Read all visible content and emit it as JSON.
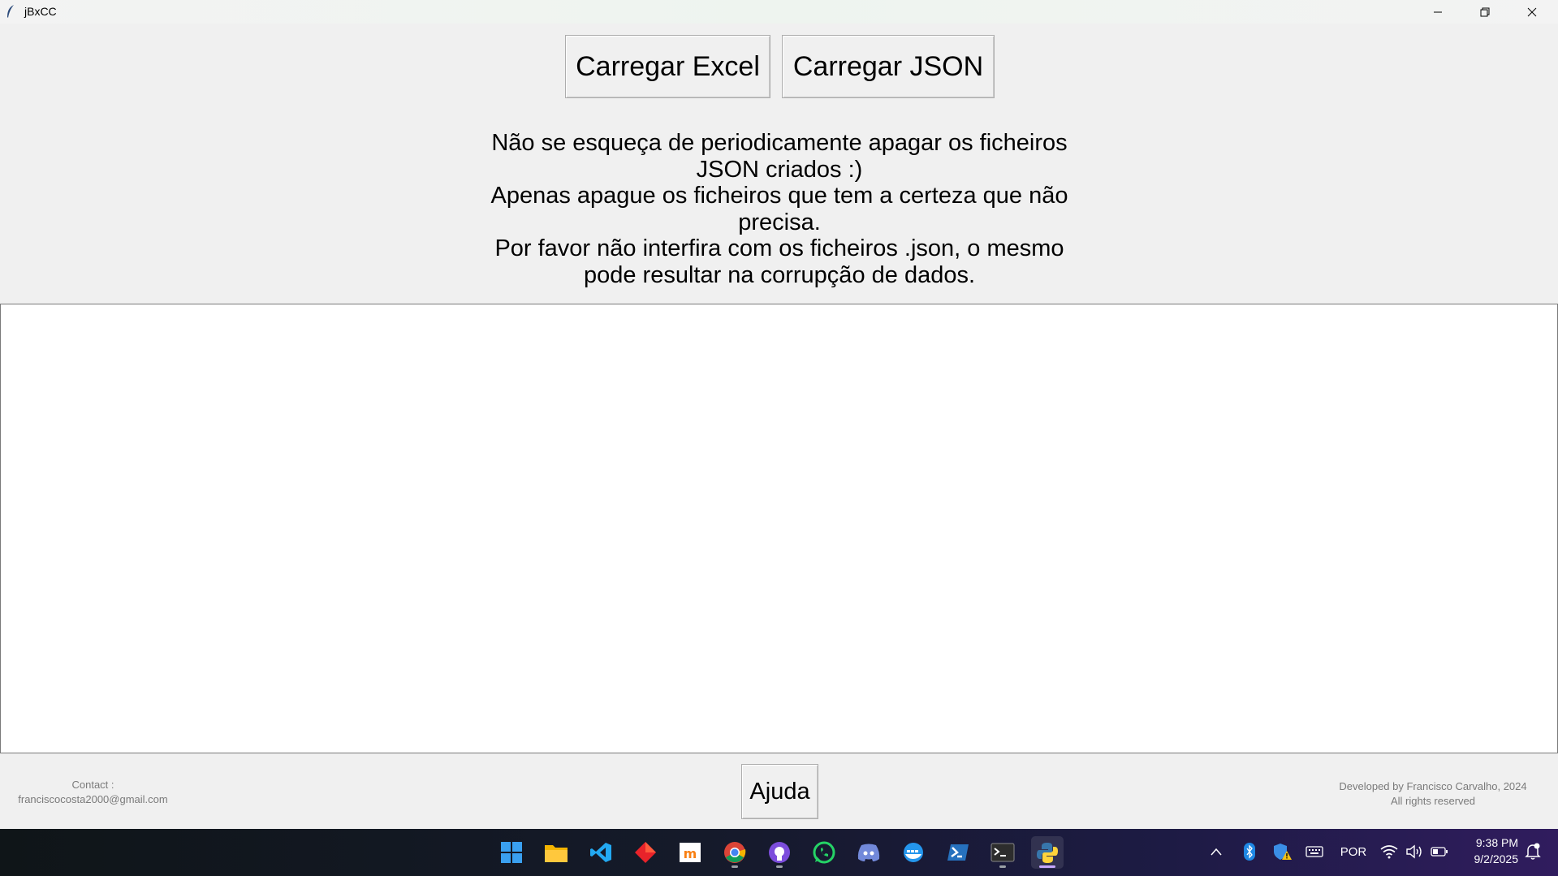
{
  "window": {
    "title": "jBxCC"
  },
  "toolbar": {
    "load_excel_label": "Carregar Excel",
    "load_json_label": "Carregar JSON"
  },
  "notice": {
    "lines": [
      "Não se esqueça de periodicamente apagar os ficheiros",
      "JSON criados :)",
      "Apenas apague os ficheiros que tem a certeza que não",
      "precisa.",
      "Por favor não interfira com os ficheiros .json, o mesmo",
      "pode resultar na corrupção de dados."
    ]
  },
  "output": {
    "value": ""
  },
  "footer": {
    "contact_label": "Contact :",
    "contact_email": "franciscocosta2000@gmail.com",
    "help_label": "Ajuda",
    "credits_line1": "Developed by Francisco Carvalho, 2024",
    "credits_line2": "All rights reserved"
  },
  "taskbar": {
    "apps": [
      {
        "name": "start-icon"
      },
      {
        "name": "file-explorer-icon"
      },
      {
        "name": "vscode-icon"
      },
      {
        "name": "git-client-icon"
      },
      {
        "name": "moodle-icon"
      },
      {
        "name": "chrome-icon",
        "running": true
      },
      {
        "name": "github-icon",
        "running": true
      },
      {
        "name": "whatsapp-icon"
      },
      {
        "name": "discord-icon"
      },
      {
        "name": "docker-icon"
      },
      {
        "name": "powershell-icon"
      },
      {
        "name": "terminal-icon",
        "running": true
      },
      {
        "name": "python-icon",
        "active": true
      }
    ],
    "language": "POR",
    "time": "9:38 PM",
    "date": "9/2/2025"
  },
  "colors": {
    "taskbar_start": "#0f1518",
    "taskbar_end": "#301c5e",
    "window_bg": "#f0f0f0"
  }
}
